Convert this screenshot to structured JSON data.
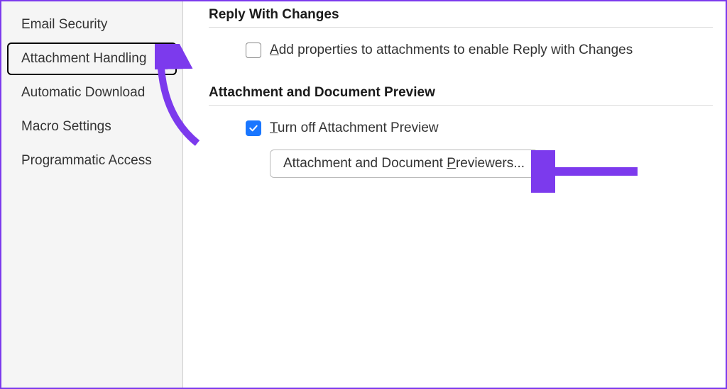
{
  "sidebar": {
    "items": [
      {
        "label": "Email Security"
      },
      {
        "label": "Attachment Handling"
      },
      {
        "label": "Automatic Download"
      },
      {
        "label": "Macro Settings"
      },
      {
        "label": "Programmatic Access"
      }
    ]
  },
  "sections": {
    "replyWithChanges": {
      "heading": "Reply With Changes",
      "option1": {
        "pre": "",
        "u": "A",
        "post": "dd properties to attachments to enable Reply with Changes",
        "checked": false
      }
    },
    "attachmentPreview": {
      "heading": "Attachment and Document Preview",
      "option1": {
        "pre": "",
        "u": "T",
        "post": "urn off Attachment Preview",
        "checked": true
      },
      "button": {
        "pre": "Attachment and Document ",
        "u": "P",
        "post": "reviewers..."
      }
    }
  },
  "colors": {
    "accent": "#7c3aed",
    "check": "#1976ff"
  }
}
